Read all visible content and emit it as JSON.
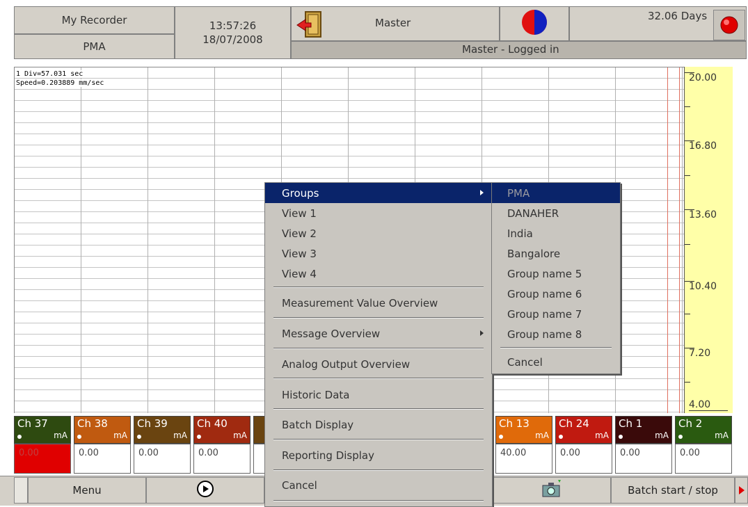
{
  "header": {
    "recorder_name": "My Recorder",
    "group_name": "PMA",
    "time": "13:57:26",
    "date": "18/07/2008",
    "user": "Master",
    "days": "32.06 Days",
    "login_status": "Master - Logged in"
  },
  "chart": {
    "division_info": "1 Div=57.031 sec",
    "speed_info": "Speed=0.203889 mm/sec",
    "scale_labels": [
      "20.00",
      "16.80",
      "13.60",
      "10.40",
      "7.20",
      "4.00"
    ]
  },
  "channels": [
    {
      "name": "Ch 37",
      "unit": "mA",
      "value": "0.00",
      "color": "#2e4a10"
    },
    {
      "name": "Ch 38",
      "unit": "mA",
      "value": "0.00",
      "color": "#c05a10"
    },
    {
      "name": "Ch 39",
      "unit": "mA",
      "value": "0.00",
      "color": "#6a4410"
    },
    {
      "name": "Ch 40",
      "unit": "mA",
      "value": "0.00",
      "color": "#a02a10"
    },
    {
      "name": "Ch 13",
      "unit": "mA",
      "value": "40.00",
      "color": "#e06a0a"
    },
    {
      "name": "Ch 24",
      "unit": "mA",
      "value": "0.00",
      "color": "#c01a10"
    },
    {
      "name": "Ch 1",
      "unit": "mA",
      "value": "0.00",
      "color": "#3a0a0a"
    },
    {
      "name": "Ch 2",
      "unit": "mA",
      "value": "0.00",
      "color": "#2a5a10"
    }
  ],
  "footer": {
    "menu_label": "Menu",
    "batch_label": "Batch start / stop"
  },
  "context_menu": {
    "items": [
      "Groups",
      "View 1",
      "View 2",
      "View 3",
      "View 4",
      "Measurement Value Overview",
      "Message Overview",
      "Analog Output Overview",
      "Historic Data",
      "Batch Display",
      "Reporting Display",
      "Cancel"
    ]
  },
  "groups_submenu": {
    "items": [
      "PMA",
      "DANAHER",
      "India",
      "Bangalore",
      "Group name 5",
      "Group name 6",
      "Group name 7",
      "Group name 8",
      "Cancel"
    ]
  },
  "colors": {
    "menu_highlight": "#0a246a",
    "scale_background": "#ffffa8",
    "alarm_red": "#e00000"
  },
  "icons": [
    "door-exit-icon",
    "pie-chart-icon",
    "alarm-indicator-icon",
    "play-icon",
    "camera-icon",
    "right-arrow-icon"
  ]
}
